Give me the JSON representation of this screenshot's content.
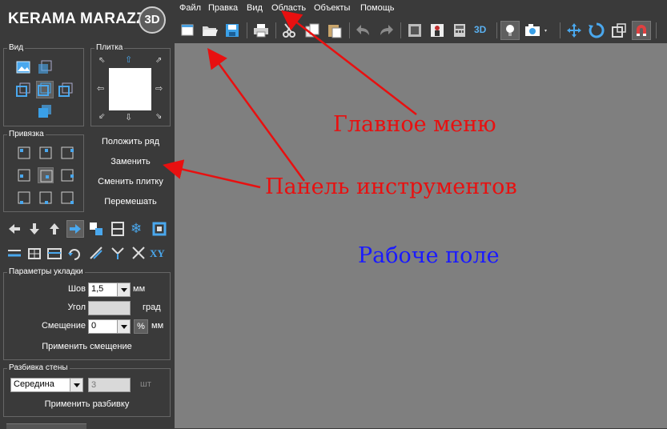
{
  "app": {
    "logo_text": "KERAMA MARAZZI",
    "logo_badge": "3D"
  },
  "menu": {
    "items": [
      "Файл",
      "Правка",
      "Вид",
      "Область",
      "Объекты",
      "Помощь"
    ]
  },
  "toolbar": {
    "icons": [
      "new-file-icon",
      "open-folder-icon",
      "save-icon",
      "print-icon",
      "cut-icon",
      "copy-icon",
      "paste-icon",
      "undo-icon",
      "redo-icon",
      "render-frame-icon",
      "render-person-icon",
      "calculator-icon",
      "view-3d-icon",
      "light-bulb-icon",
      "camera-icon",
      "move-icon",
      "rotate-icon",
      "resize-icon",
      "magnet-icon"
    ],
    "view_3d_label": "3D"
  },
  "sidebar": {
    "view_group": {
      "label": "Вид"
    },
    "tile_group": {
      "label": "Плитка"
    },
    "snap_group": {
      "label": "Привязка"
    },
    "actions": [
      "Положить ряд",
      "Заменить",
      "Сменить плитку",
      "Перемешать"
    ],
    "tool_row2_label": "XY",
    "layout_params": {
      "label": "Параметры укладки",
      "seam_label": "Шов",
      "seam_value": "1,5",
      "seam_unit": "мм",
      "angle_label": "Угол",
      "angle_value": "",
      "angle_unit": "град",
      "offset_label": "Смещение",
      "offset_value": "0",
      "offset_percent_label": "%",
      "offset_unit": "мм",
      "apply_offset_label": "Применить смещение"
    },
    "wall_split": {
      "label": "Разбивка стены",
      "mode_value": "Середина",
      "count_value": "3",
      "count_unit": "шт",
      "apply_label": "Применить разбивку"
    }
  },
  "annotations": {
    "main_menu": "Главное меню",
    "tool_panel": "Панель инструментов",
    "work_field": "Рабоче поле"
  },
  "colors": {
    "annotation_red": "#e81010",
    "annotation_blue": "#1a1aff",
    "canvas_bg": "#7f7f7f",
    "panel_bg": "#3a3a3a",
    "accent_blue": "#3aa0e8"
  }
}
